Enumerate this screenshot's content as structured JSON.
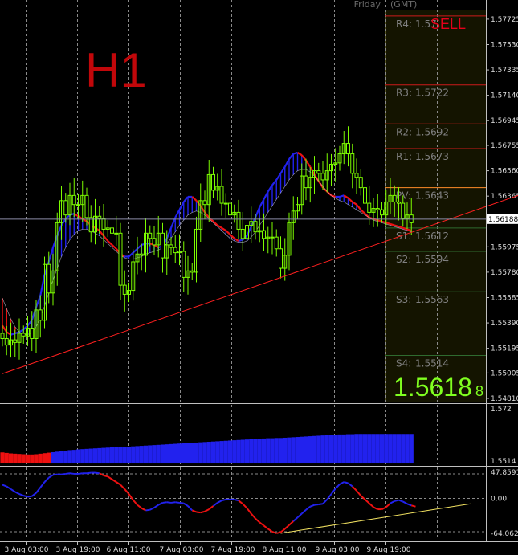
{
  "header": {
    "day": "Friday",
    "tz": "(GMT)"
  },
  "timeframe": "H1",
  "signal": "SELL",
  "current_price": {
    "main": "1.5618",
    "small": "8",
    "axis_label": "1.56188",
    "value": 1.56188
  },
  "colors": {
    "up": "#2222ee",
    "down": "#ee1111",
    "candle": "#7cfc00",
    "pivot_line": "#cc1a1a",
    "zone": "#151500",
    "accent": "#80ff20"
  },
  "pivots": [
    {
      "label": "R4:",
      "value_text": "1.57",
      "value": 1.5775
    },
    {
      "label": "R3:",
      "value_text": "1.5722",
      "value": 1.5722
    },
    {
      "label": "R2:",
      "value_text": "1.5692",
      "value": 1.5692
    },
    {
      "label": "R1:",
      "value_text": "1.5673",
      "value": 1.5673
    },
    {
      "label": "PV:",
      "value_text": "1.5643",
      "value": 1.5643
    },
    {
      "label": "S1:",
      "value_text": "1.5612",
      "value": 1.5612
    },
    {
      "label": "S2:",
      "value_text": "1.5594",
      "value": 1.5594
    },
    {
      "label": "S3:",
      "value_text": "1.5563",
      "value": 1.5563
    },
    {
      "label": "S4:",
      "value_text": "1.5514",
      "value": 1.5514
    }
  ],
  "chart_data": {
    "type": "candlestick",
    "main": {
      "y_ticks": [
        "1.57725",
        "1.57530",
        "1.57335",
        "1.57140",
        "1.56945",
        "1.56755",
        "1.56560",
        "1.56365",
        "1.56170",
        "1.55975",
        "1.55780",
        "1.55585",
        "1.55390",
        "1.55195",
        "1.55005",
        "1.54810"
      ],
      "ylim": [
        1.5481,
        1.5778
      ],
      "close": [
        1.5527,
        1.5522,
        1.5526,
        1.5524,
        1.5531,
        1.5529,
        1.5535,
        1.5527,
        1.5549,
        1.5541,
        1.5584,
        1.5562,
        1.5579,
        1.5616,
        1.5633,
        1.5622,
        1.5637,
        1.563,
        1.563,
        1.5637,
        1.562,
        1.5609,
        1.5621,
        1.5619,
        1.5611,
        1.5612,
        1.5608,
        1.5608,
        1.5568,
        1.5561,
        1.5564,
        1.5586,
        1.5592,
        1.5591,
        1.5608,
        1.5604,
        1.5599,
        1.5608,
        1.5589,
        1.5599,
        1.5597,
        1.5593,
        1.5594,
        1.5574,
        1.5579,
        1.5578,
        1.5611,
        1.5633,
        1.563,
        1.5653,
        1.5641,
        1.5644,
        1.5631,
        1.5631,
        1.5622,
        1.5624,
        1.5611,
        1.5604,
        1.5614,
        1.5617,
        1.5609,
        1.561,
        1.5604,
        1.5605,
        1.5605,
        1.5596,
        1.5581,
        1.5591,
        1.5616,
        1.5625,
        1.563,
        1.5652,
        1.5643,
        1.5651,
        1.5656,
        1.5654,
        1.5649,
        1.5656,
        1.5661,
        1.5662,
        1.5669,
        1.5677,
        1.5669,
        1.5654,
        1.5651,
        1.5643,
        1.5631,
        1.5624,
        1.5627,
        1.5626,
        1.5622,
        1.5632,
        1.5637,
        1.5632,
        1.5631,
        1.5619,
        1.5622,
        1.5616
      ],
      "ma_fast": [
        1.5537,
        1.5532,
        1.553,
        1.5531,
        1.5532,
        1.5534,
        1.5537,
        1.5541,
        1.5551,
        1.556,
        1.5576,
        1.5586,
        1.5597,
        1.5606,
        1.5614,
        1.5619,
        1.5622,
        1.5623,
        1.5621,
        1.5619,
        1.5617,
        1.5614,
        1.5612,
        1.561,
        1.5606,
        1.5602,
        1.5599,
        1.5596,
        1.5592,
        1.559,
        1.559,
        1.5593,
        1.5596,
        1.5599,
        1.56,
        1.56,
        1.5599,
        1.5597,
        1.5598,
        1.5604,
        1.5612,
        1.562,
        1.5626,
        1.5632,
        1.5636,
        1.5636,
        1.5633,
        1.5629,
        1.5624,
        1.562,
        1.5617,
        1.5614,
        1.5612,
        1.561,
        1.5607,
        1.5604,
        1.5602,
        1.5603,
        1.5606,
        1.5613,
        1.562,
        1.5628,
        1.5634,
        1.564,
        1.5645,
        1.5649,
        1.5654,
        1.5659,
        1.5665,
        1.5669,
        1.567,
        1.5668,
        1.5664,
        1.5659,
        1.5653,
        1.5648,
        1.5643,
        1.564,
        1.5637,
        1.5636,
        1.5636,
        1.5637,
        1.5635,
        1.5632,
        1.563,
        1.5626,
        1.5623,
        1.562,
        1.5619,
        1.5618,
        1.5617,
        1.5616,
        1.5615,
        1.5614,
        1.5613,
        1.5612,
        1.5611,
        1.561
      ],
      "ma_slow": [
        1.5558,
        1.555,
        1.5542,
        1.5536,
        1.5532,
        1.553,
        1.553,
        1.5532,
        1.5536,
        1.5543,
        1.5552,
        1.5562,
        1.5572,
        1.5581,
        1.559,
        1.5597,
        1.5603,
        1.5607,
        1.561,
        1.5611,
        1.5611,
        1.561,
        1.5608,
        1.5606,
        1.5603,
        1.56,
        1.5597,
        1.5594,
        1.5591,
        1.5589,
        1.5588,
        1.5588,
        1.5589,
        1.559,
        1.5592,
        1.5593,
        1.5594,
        1.5595,
        1.5597,
        1.56,
        1.5604,
        1.5609,
        1.5614,
        1.5618,
        1.5622,
        1.5624,
        1.5625,
        1.5624,
        1.5622,
        1.5619,
        1.5616,
        1.5613,
        1.561,
        1.5607,
        1.5604,
        1.5602,
        1.5601,
        1.5601,
        1.5602,
        1.5605,
        1.5609,
        1.5614,
        1.5619,
        1.5624,
        1.5629,
        1.5634,
        1.5639,
        1.5644,
        1.5649,
        1.5653,
        1.5656,
        1.5657,
        1.5657,
        1.5655,
        1.5652,
        1.5648,
        1.5644,
        1.564,
        1.5637,
        1.5635,
        1.5633,
        1.5632,
        1.563,
        1.5628,
        1.5626,
        1.5624,
        1.5622,
        1.562,
        1.5618,
        1.5617,
        1.5616,
        1.5615,
        1.5614,
        1.5613,
        1.5612,
        1.5611,
        1.561,
        1.5609
      ],
      "trendline": [
        [
          0,
          1.55
        ],
        [
          125,
          1.564
        ]
      ]
    },
    "histogram": {
      "y_ticks": [
        "1.572",
        "1.5514"
      ],
      "ylim": [
        1.5514,
        1.572
      ],
      "values": [
        1.5548,
        1.5546,
        1.5544,
        1.5543,
        1.5542,
        1.5541,
        1.554,
        1.554,
        1.5541,
        1.5543,
        1.5545,
        1.5547,
        1.5549,
        1.5551,
        1.5553,
        1.5555,
        1.5557,
        1.5558,
        1.556,
        1.5561,
        1.5562,
        1.5563,
        1.5564,
        1.5565,
        1.5566,
        1.5567,
        1.5568,
        1.5569,
        1.557,
        1.557,
        1.5571,
        1.5572,
        1.5573,
        1.5574,
        1.5575,
        1.5576,
        1.5577,
        1.5578,
        1.5579,
        1.558,
        1.5581,
        1.5582,
        1.5583,
        1.5584,
        1.5585,
        1.5586,
        1.5587,
        1.5588,
        1.5589,
        1.559,
        1.5591,
        1.5592,
        1.5593,
        1.5594,
        1.5595,
        1.5596,
        1.5597,
        1.5598,
        1.5599,
        1.56,
        1.5601,
        1.5602,
        1.5603,
        1.5604,
        1.5604,
        1.5605,
        1.5605,
        1.5606,
        1.5607,
        1.5608,
        1.5609,
        1.561,
        1.5611,
        1.5612,
        1.5613,
        1.5614,
        1.5615,
        1.5616,
        1.5617,
        1.5618,
        1.5619,
        1.5619,
        1.562,
        1.562,
        1.5621,
        1.5621,
        1.5621,
        1.5621,
        1.5621,
        1.5621,
        1.5621,
        1.5621,
        1.5621,
        1.5621,
        1.5621,
        1.5621,
        1.5621,
        1.5621
      ],
      "colors": "rrrrrrrrrrrrbbbbbbbbbbbbbbbbbbbbbbbbbbbbbbbbbbbbbbbbbbbbbbbbbbbbbbbbbbbbbbbbbbbbbbbbbbbbbbbbbbbbbbb"
    },
    "oscillator": {
      "y_ticks": [
        "47.8591",
        "0.00",
        "-64.0628"
      ],
      "ylim": [
        -64.0628,
        47.8591
      ],
      "values": [
        25,
        22,
        17,
        12,
        8,
        5,
        3,
        4,
        10,
        20,
        30,
        38,
        43,
        44,
        44,
        45,
        46,
        45,
        45,
        46,
        46,
        47,
        47,
        46,
        42,
        40,
        35,
        30,
        25,
        17,
        8,
        -3,
        -12,
        -18,
        -22,
        -21,
        -17,
        -12,
        -8,
        -7,
        -8,
        -7,
        -8,
        -9,
        -14,
        -22,
        -25,
        -26,
        -24,
        -20,
        -14,
        -8,
        -4,
        -2,
        -2,
        -2,
        -4,
        -10,
        -18,
        -28,
        -37,
        -44,
        -50,
        -56,
        -61,
        -64,
        -62,
        -56,
        -49,
        -42,
        -35,
        -28,
        -21,
        -15,
        -12,
        -11,
        -10,
        -2,
        8,
        18,
        26,
        30,
        28,
        22,
        14,
        5,
        -2,
        -9,
        -16,
        -20,
        -20,
        -16,
        -9,
        -5,
        -3,
        -6,
        -10,
        -13,
        -15
      ],
      "colors": "bbbbbbbbbbbbbbbbbbbbbbbbrrrrrrrrrrrbbbbbbbbbbbrrrrrbbbbbbrrrrrrrrrrrrrbbbbbbbbbbbbbbrrrrrrrrrbbbbbrrrr",
      "trendline": [
        [
          66,
          -64.0
        ],
        [
          111,
          -10.0
        ]
      ]
    },
    "x_tick_labels": [
      "3 Aug 03:00",
      "3 Aug 19:00",
      "6 Aug 11:00",
      "7 Aug 03:00",
      "7 Aug 19:00",
      "8 Aug 11:00",
      "9 Aug 03:00",
      "9 Aug 19:00"
    ]
  }
}
